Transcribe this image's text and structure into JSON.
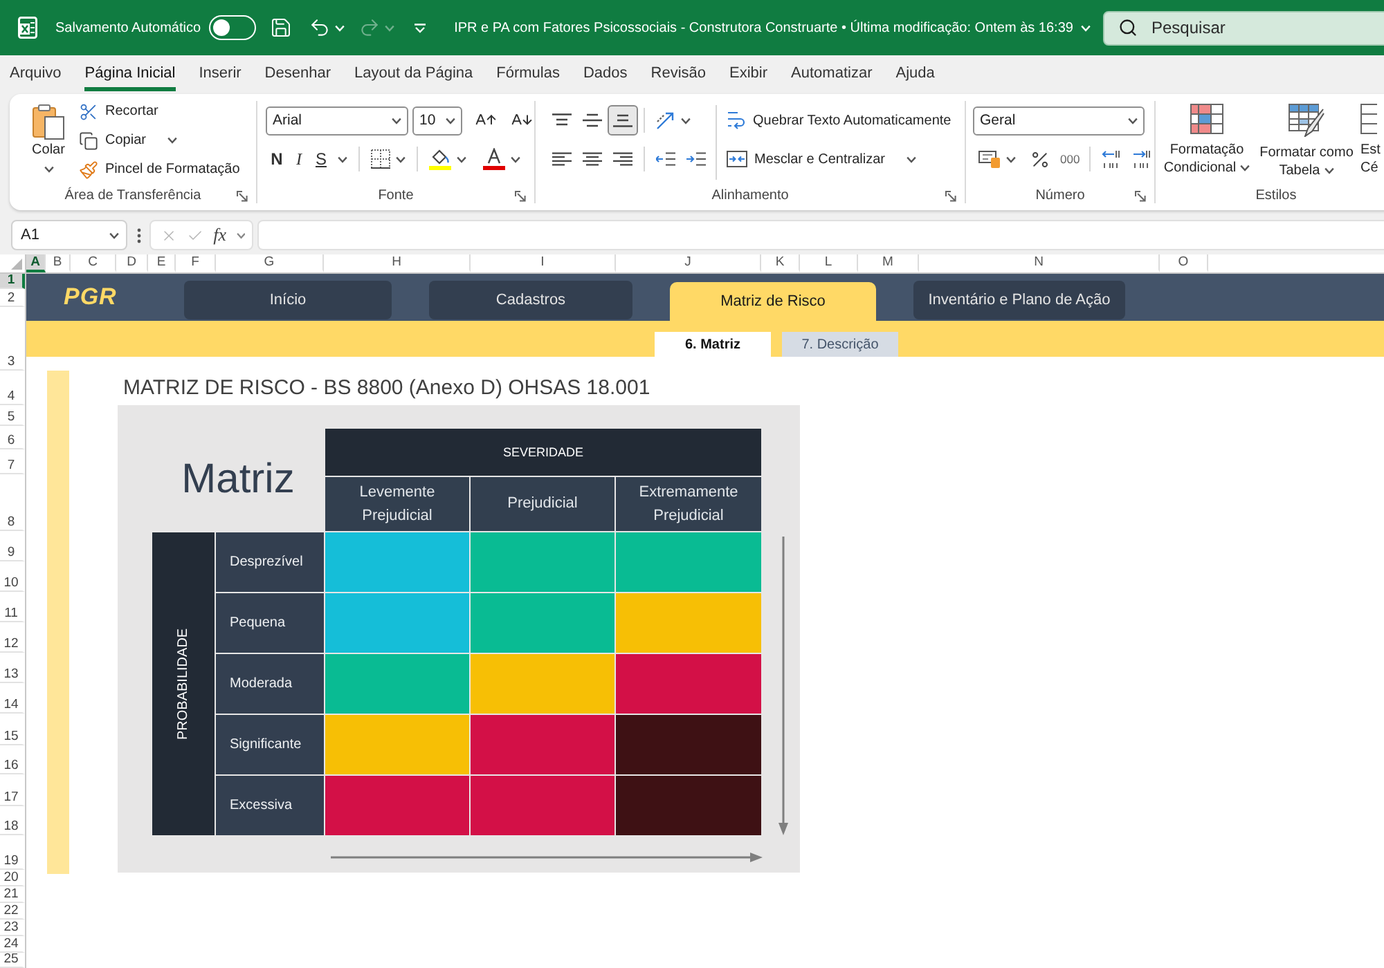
{
  "title_bar": {
    "autosave": {
      "label": "Salvamento Automático",
      "on": false
    },
    "redo": {
      "disabled": true
    },
    "document_title": "IPR e PA com Fatores Psicossociais - Construtora Construarte • Última modificação: Ontem às 16:39",
    "search": {
      "placeholder": "Pesquisar"
    }
  },
  "menu_tabs": [
    {
      "label": "Arquivo",
      "selected": false
    },
    {
      "label": "Página Inicial",
      "selected": true
    },
    {
      "label": "Inserir",
      "selected": false
    },
    {
      "label": "Desenhar",
      "selected": false
    },
    {
      "label": "Layout da Página",
      "selected": false
    },
    {
      "label": "Fórmulas",
      "selected": false
    },
    {
      "label": "Dados",
      "selected": false
    },
    {
      "label": "Revisão",
      "selected": false
    },
    {
      "label": "Exibir",
      "selected": false
    },
    {
      "label": "Automatizar",
      "selected": false
    },
    {
      "label": "Ajuda",
      "selected": false
    }
  ],
  "ribbon": {
    "clipboard": {
      "label": "Área de Transferência",
      "paste": "Colar",
      "cut": "Recortar",
      "copy": "Copiar",
      "format_painter": "Pincel de Formatação"
    },
    "font": {
      "label": "Fonte",
      "font_name": "Arial",
      "font_size": "10",
      "bold": "N",
      "italic": "I",
      "underline": "S"
    },
    "alignment": {
      "label": "Alinhamento",
      "vertical_align": [
        {
          "kind": "top",
          "selected": false
        },
        {
          "kind": "middle",
          "selected": false
        },
        {
          "kind": "bottom",
          "selected": true
        }
      ],
      "wrap_text": "Quebrar Texto Automaticamente",
      "merge_center": "Mesclar e Centralizar"
    },
    "number": {
      "label": "Número",
      "format": "Geral",
      "thousands": "000"
    },
    "styles": {
      "label": "Estilos",
      "buttons": [
        {
          "kind": "conditional",
          "lines": [
            "Formatação",
            "Condicional"
          ]
        },
        {
          "kind": "table",
          "lines": [
            "Formatar como",
            "Tabela"
          ]
        },
        {
          "kind": "cell",
          "lines": [
            "Est",
            "Cé"
          ]
        }
      ]
    }
  },
  "formula_bar": {
    "name_box": "A1",
    "function_button": "fx"
  },
  "sheet": {
    "column_headers": [
      {
        "label": "A",
        "selected": true
      },
      {
        "label": "B",
        "selected": false
      },
      {
        "label": "C",
        "selected": false
      },
      {
        "label": "D",
        "selected": false
      },
      {
        "label": "E",
        "selected": false
      },
      {
        "label": "F",
        "selected": false
      },
      {
        "label": "G",
        "selected": false
      },
      {
        "label": "H",
        "selected": false
      },
      {
        "label": "I",
        "selected": false
      },
      {
        "label": "J",
        "selected": false
      },
      {
        "label": "K",
        "selected": false
      },
      {
        "label": "L",
        "selected": false
      },
      {
        "label": "M",
        "selected": false
      },
      {
        "label": "N",
        "selected": false
      },
      {
        "label": "O",
        "selected": false
      }
    ],
    "row_headers": [
      {
        "label": "1",
        "selected": true
      },
      {
        "label": "2",
        "selected": false
      },
      {
        "label": "3",
        "selected": false
      },
      {
        "label": "4",
        "selected": false
      },
      {
        "label": "5",
        "selected": false
      },
      {
        "label": "6",
        "selected": false
      },
      {
        "label": "7",
        "selected": false
      },
      {
        "label": "8",
        "selected": false
      },
      {
        "label": "9",
        "selected": false
      },
      {
        "label": "10",
        "selected": false
      },
      {
        "label": "11",
        "selected": false
      },
      {
        "label": "12",
        "selected": false
      },
      {
        "label": "13",
        "selected": false
      },
      {
        "label": "14",
        "selected": false
      },
      {
        "label": "15",
        "selected": false
      },
      {
        "label": "16",
        "selected": false
      },
      {
        "label": "17",
        "selected": false
      },
      {
        "label": "18",
        "selected": false
      },
      {
        "label": "19",
        "selected": false
      },
      {
        "label": "20",
        "selected": false
      },
      {
        "label": "21",
        "selected": false
      },
      {
        "label": "22",
        "selected": false
      },
      {
        "label": "23",
        "selected": false
      },
      {
        "label": "24",
        "selected": false
      },
      {
        "label": "25",
        "selected": false
      }
    ]
  },
  "navigation": {
    "logo": "PGR",
    "items": [
      {
        "label": "Início",
        "selected": false
      },
      {
        "label": "Cadastros",
        "selected": false
      },
      {
        "label": "Matriz de Risco",
        "selected": true
      },
      {
        "label": "Inventário e Plano de Ação",
        "selected": false
      }
    ],
    "sub_tabs": [
      {
        "label": "6. Matriz",
        "selected": true
      },
      {
        "label": "7. Descrição",
        "selected": false
      }
    ]
  },
  "matrix": {
    "title": "MATRIZ DE RISCO - BS 8800 (Anexo D) OHSAS 18.001",
    "heading": "Matriz",
    "severity_label": "SEVERIDADE",
    "severity_levels": [
      "Levemente Prejudicial",
      "Prejudicial",
      "Extremamente Prejudicial"
    ],
    "probability_label": "PROBABILIDADE",
    "rows": [
      {
        "label": "Desprezível",
        "cells": [
          {
            "color": "#15bed8"
          },
          {
            "color": "#09bb93"
          },
          {
            "color": "#09bb93"
          }
        ]
      },
      {
        "label": "Pequena",
        "cells": [
          {
            "color": "#15bed8"
          },
          {
            "color": "#09bb93"
          },
          {
            "color": "#f7bf05"
          }
        ]
      },
      {
        "label": "Moderada",
        "cells": [
          {
            "color": "#09bb93"
          },
          {
            "color": "#f7bf05"
          },
          {
            "color": "#d31047"
          }
        ]
      },
      {
        "label": "Significante",
        "cells": [
          {
            "color": "#f7bf05"
          },
          {
            "color": "#d31047"
          },
          {
            "color": "#3e1114"
          }
        ]
      },
      {
        "label": "Excessiva",
        "cells": [
          {
            "color": "#d31047"
          },
          {
            "color": "#d31047"
          },
          {
            "color": "#3e1114"
          }
        ]
      }
    ]
  }
}
